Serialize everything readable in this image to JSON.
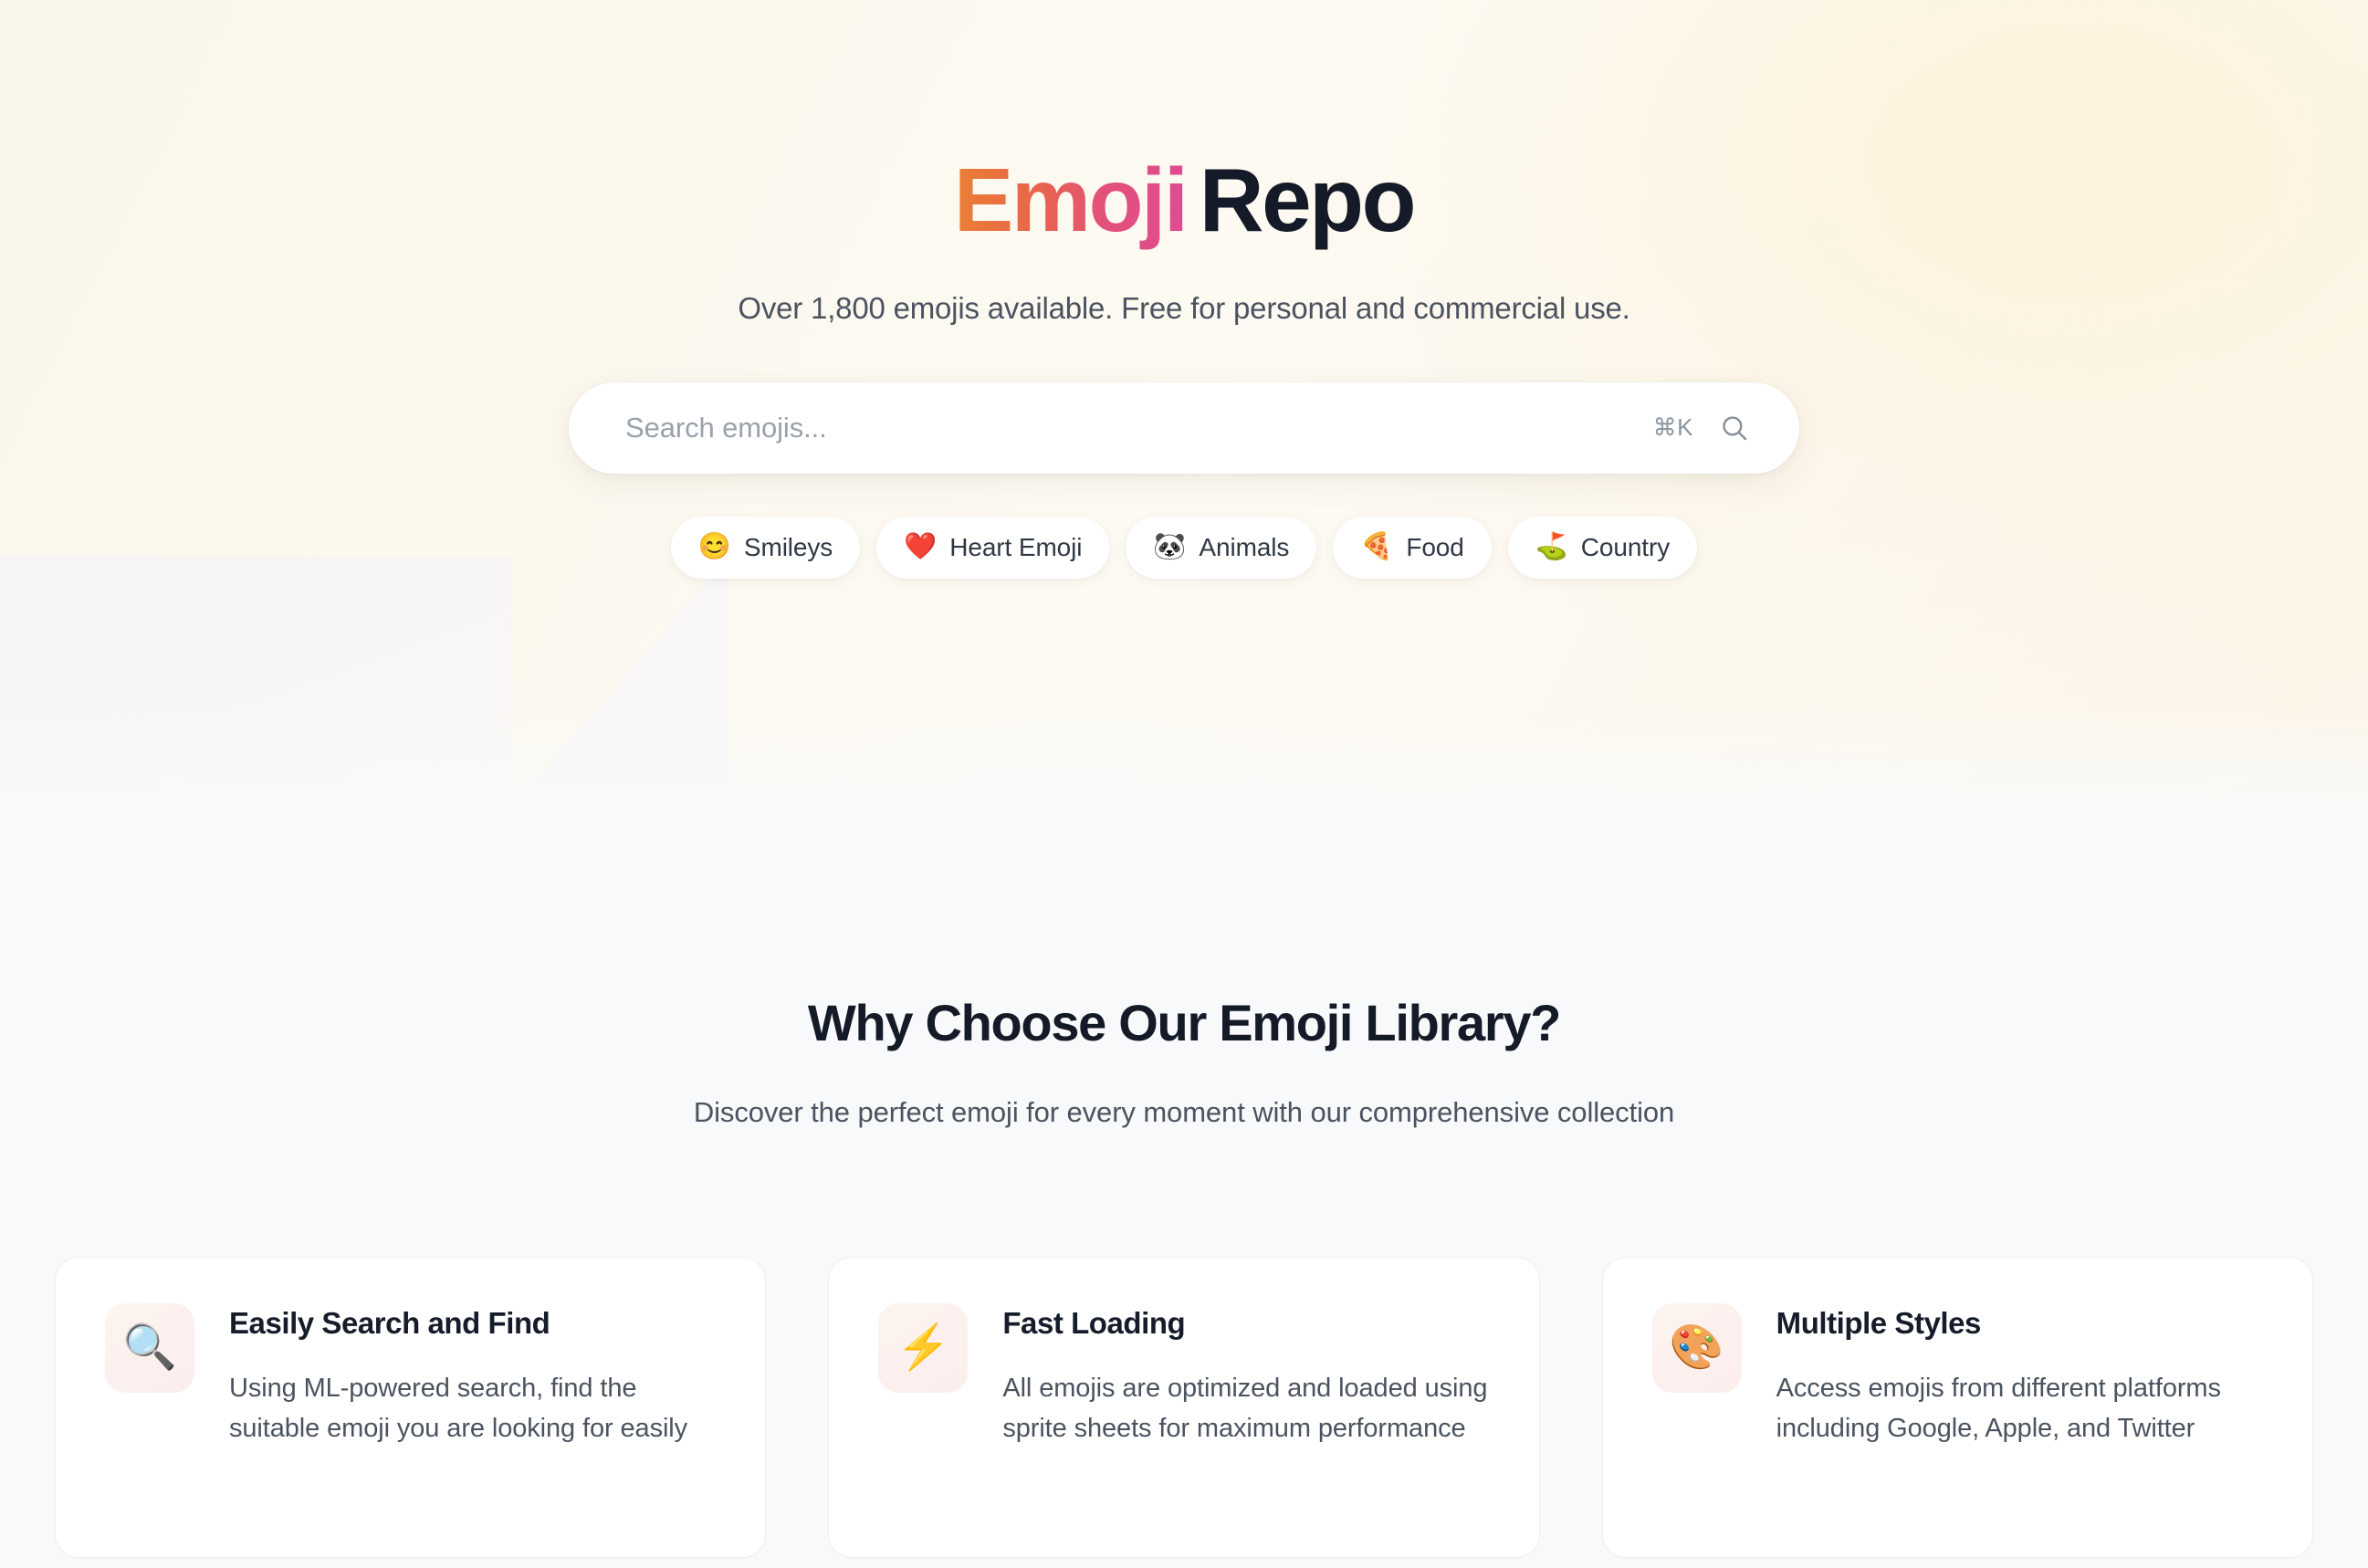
{
  "hero": {
    "brand_first": "Emoji",
    "brand_second": "Repo",
    "subtitle": "Over 1,800 emojis available. Free for personal and commercial use.",
    "colors": {
      "gradient_start": "#ea7f35",
      "gradient_end": "#df4b92",
      "brand_dark": "#141a27",
      "background": "#fcf8ee"
    }
  },
  "search": {
    "placeholder": "Search emojis...",
    "value": "",
    "shortcut": "⌘K",
    "icon": "search-icon"
  },
  "categories": [
    {
      "emoji": "😊",
      "label": "Smileys",
      "icon_name": "smiling-face-icon"
    },
    {
      "emoji": "❤️",
      "label": "Heart Emoji",
      "icon_name": "red-heart-icon"
    },
    {
      "emoji": "🐼",
      "label": "Animals",
      "icon_name": "panda-icon"
    },
    {
      "emoji": "🍕",
      "label": "Food",
      "icon_name": "pizza-icon"
    },
    {
      "emoji": "⛳",
      "label": "Country",
      "icon_name": "flag-in-hole-icon"
    }
  ],
  "features": {
    "title": "Why Choose Our Emoji Library?",
    "subtitle": "Discover the perfect emoji for every moment with our comprehensive collection",
    "cards": [
      {
        "emoji": "🔍",
        "icon_name": "magnifying-glass-icon",
        "title": "Easily Search and Find",
        "text": "Using ML-powered search, find the suitable emoji you are looking for easily"
      },
      {
        "emoji": "⚡",
        "icon_name": "lightning-bolt-icon",
        "title": "Fast Loading",
        "text": "All emojis are optimized and loaded using sprite sheets for maximum performance"
      },
      {
        "emoji": "🎨",
        "icon_name": "artist-palette-icon",
        "title": "Multiple Styles",
        "text": "Access emojis from different platforms including Google, Apple, and Twitter"
      }
    ]
  }
}
